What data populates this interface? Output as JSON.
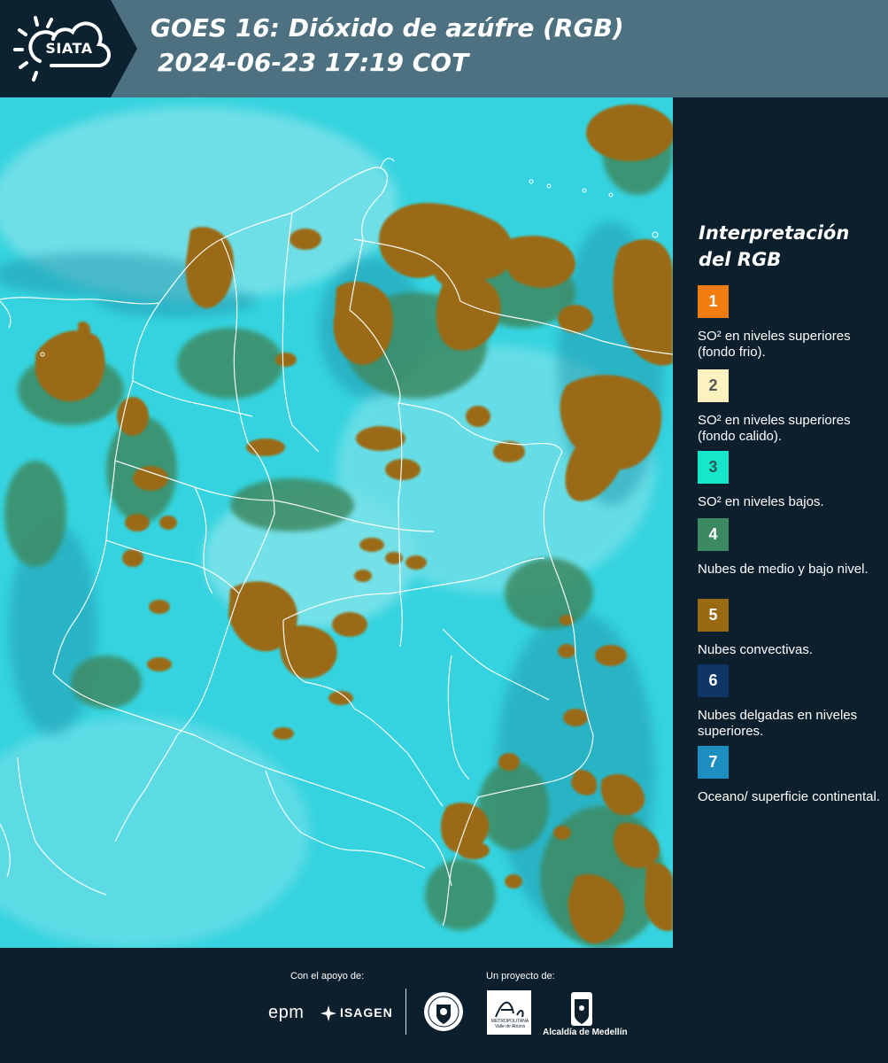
{
  "header": {
    "logo_text": "SIATA",
    "title": "GOES 16: Dióxido de azúfre (RGB)",
    "datetime": "2024-06-23 17:19 COT"
  },
  "legend": {
    "title": "Interpretación del RGB",
    "items": [
      {
        "number": "1",
        "label": "SO² en niveles superiores (fondo frio).",
        "color": "#f27c0f",
        "text_color": "#ffffff"
      },
      {
        "number": "2",
        "label": "SO² en niveles superiores (fondo calido).",
        "color": "#fbf2c0",
        "text_color": "#555555"
      },
      {
        "number": "3",
        "label": "SO² en niveles bajos.",
        "color": "#16e6c9",
        "text_color": "#245a5a"
      },
      {
        "number": "4",
        "label": "Nubes de medio y bajo nivel.",
        "color": "#3d8a62",
        "text_color": "#ffffff"
      },
      {
        "number": "5",
        "label": "Nubes convectivas.",
        "color": "#9a6a13",
        "text_color": "#ffffff"
      },
      {
        "number": "6",
        "label": "Nubes delgadas en niveles superiores.",
        "color": "#0e3566",
        "text_color": "#ffffff"
      },
      {
        "number": "7",
        "label": "Oceano/ superficie continental.",
        "color": "#1d8ec0",
        "text_color": "#ffffff"
      }
    ]
  },
  "footer": {
    "support_label": "Con el apoyo de:",
    "project_label": "Un proyecto de:",
    "sponsor_1": "epm",
    "sponsor_2": "ISAGEN",
    "partner_1": "Área",
    "partner_1_sub": "METROPOLITANA Valle de Aburrá",
    "partner_2": "Alcaldía de Medellín"
  },
  "colors": {
    "background": "#35d3df",
    "convective": "#9a6a13",
    "low_mid": "#3d8a62",
    "border_lines": "#ffffff",
    "panel": "#0c1f2c",
    "header": "#4d7180"
  }
}
